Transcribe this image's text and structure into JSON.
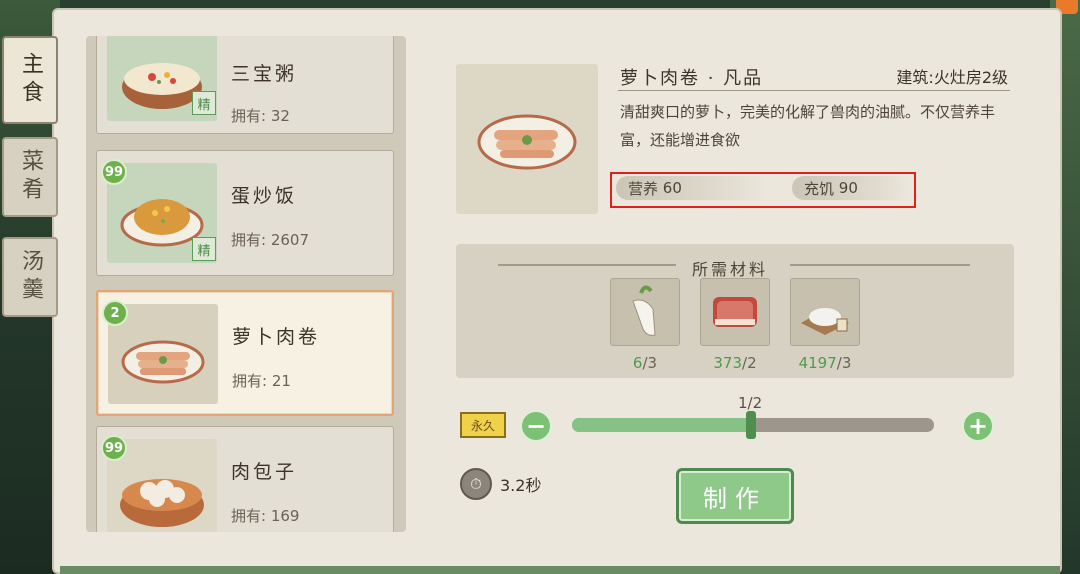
{
  "tabs": [
    {
      "label": "主食",
      "active": true
    },
    {
      "label": "菜肴",
      "active": false
    },
    {
      "label": "汤羹",
      "active": false
    }
  ],
  "recipes": [
    {
      "name": "三宝粥",
      "own": "拥有: 32",
      "badge": "",
      "jing": "精"
    },
    {
      "name": "蛋炒饭",
      "own": "拥有: 2607",
      "badge": "99",
      "jing": "精"
    },
    {
      "name": "萝卜肉卷",
      "own": "拥有: 21",
      "badge": "2",
      "jing": "",
      "selected": true
    },
    {
      "name": "肉包子",
      "own": "拥有: 169",
      "badge": "99",
      "jing": ""
    }
  ],
  "detail": {
    "title": "萝卜肉卷 · 凡品",
    "building": "建筑:火灶房2级",
    "description": "清甜爽口的萝卜，完美的化解了兽肉的油腻。不仅营养丰富，还能增进食欲",
    "stats": [
      {
        "label": "营养",
        "value": "60"
      },
      {
        "label": "充饥",
        "value": "90"
      }
    ]
  },
  "materials": {
    "title": "所需材料",
    "items": [
      {
        "icon": "radish-icon",
        "have": "6",
        "need": "/3"
      },
      {
        "icon": "meat-icon",
        "have": "373",
        "need": "/2"
      },
      {
        "icon": "flour-icon",
        "have": "4197",
        "need": "/3"
      }
    ]
  },
  "craft": {
    "tag": "永久",
    "counter": "1/2",
    "progress": 0.5,
    "time": "3.2秒",
    "make_label": "制作"
  },
  "colors": {
    "accent_green": "#86c286",
    "highlight_red": "#e0201c",
    "selected_border": "#e0a678"
  }
}
